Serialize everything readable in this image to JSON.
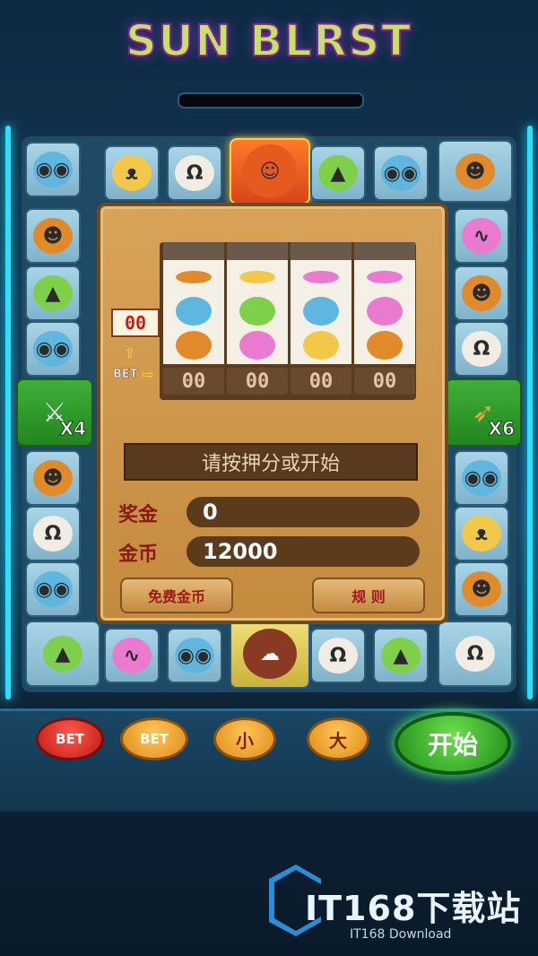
{
  "game": {
    "title": "SUN BLRST",
    "colors": {
      "neon": "#29e0ff",
      "panel": "#c48a3e",
      "title": "#c7e06a"
    }
  },
  "board": {
    "top_tiles": [
      "owl",
      "lion",
      "goat",
      "warrior",
      "wolf",
      "owl",
      "monkey"
    ],
    "left_tiles": [
      "monkey",
      "wolf",
      "owl",
      "swords",
      "monkey",
      "goat",
      "owl"
    ],
    "right_tiles": [
      "elephant",
      "monkey",
      "goat",
      "bow",
      "owl",
      "lion",
      "monkey"
    ],
    "bottom_tiles": [
      "wolf",
      "elephant",
      "owl",
      "volcano",
      "goat",
      "wolf",
      "goat"
    ],
    "left_multiplier": "X4",
    "right_multiplier": "X6"
  },
  "machine": {
    "side_counter": "00",
    "bet_label": "BET",
    "reel_values": [
      "00",
      "00",
      "00",
      "00"
    ],
    "status_text": "请按押分或开始",
    "prize_label": "奖金",
    "prize_value": "0",
    "coins_label": "金币",
    "coins_value": "12000",
    "free_coins_button": "免费金币",
    "rules_button": "规 则"
  },
  "controls": {
    "bet1_label": "BET",
    "bet2_label": "BET",
    "small_label": "小",
    "big_label": "大",
    "start_label": "开始"
  },
  "watermark": {
    "main": "IT168下载站",
    "sub": "IT168 Download"
  }
}
